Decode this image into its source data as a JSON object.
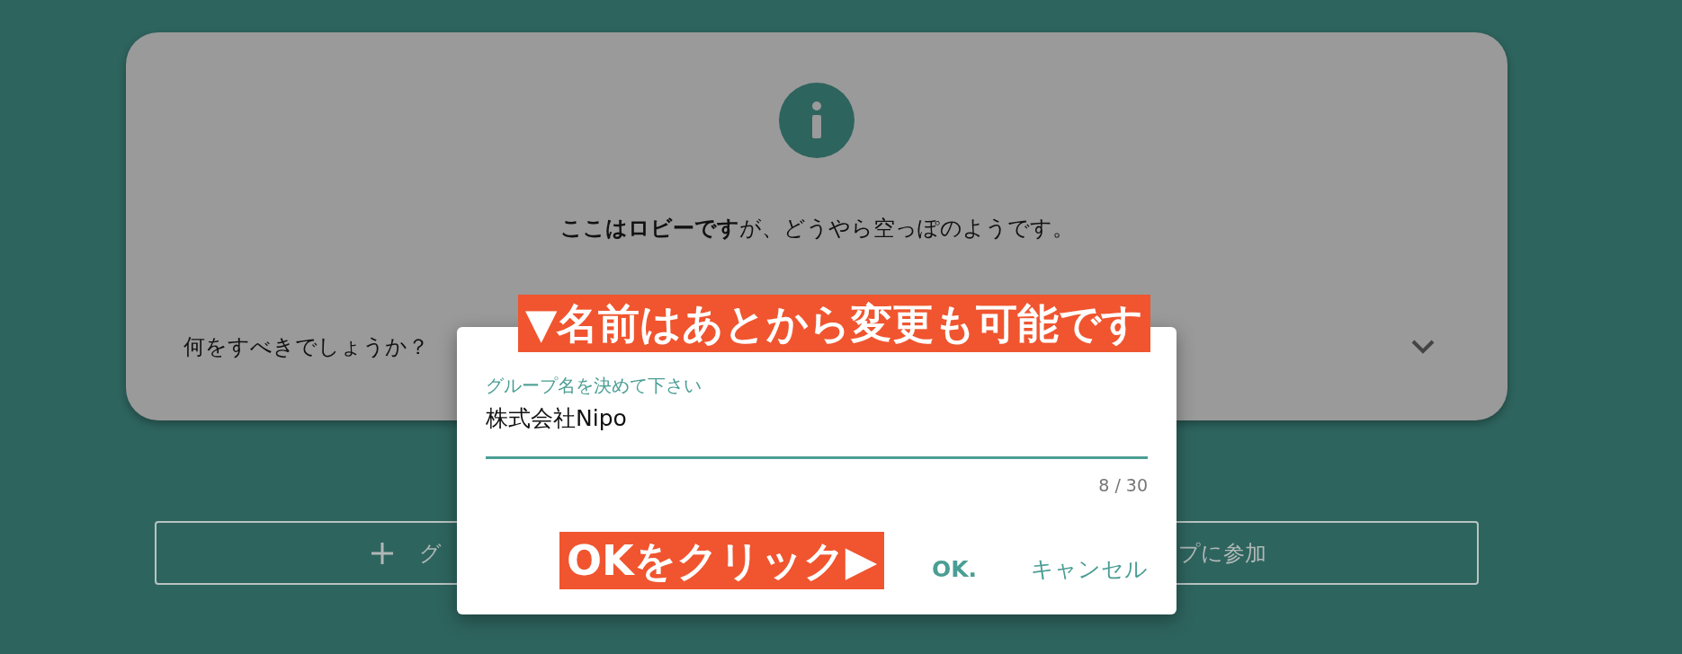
{
  "lobby_card": {
    "message": "**ここはロビーです**が、どうやら空っぽのようです。",
    "faq": {
      "label": "何をすべきでしょうか？",
      "expanded": false
    }
  },
  "actions": {
    "create_text": "グ",
    "join_text": "プに参加"
  },
  "dialog": {
    "field": {
      "label": "グループ名を決めて下さい",
      "value": "株式会社Nipo",
      "counter": "8 / 30"
    },
    "buttons": [
      "OK.",
      "キャンセル"
    ]
  },
  "annotations": [
    {
      "text": "▼名前はあとから変更も可能です"
    },
    {
      "text": "OKをクリック▶"
    }
  ]
}
